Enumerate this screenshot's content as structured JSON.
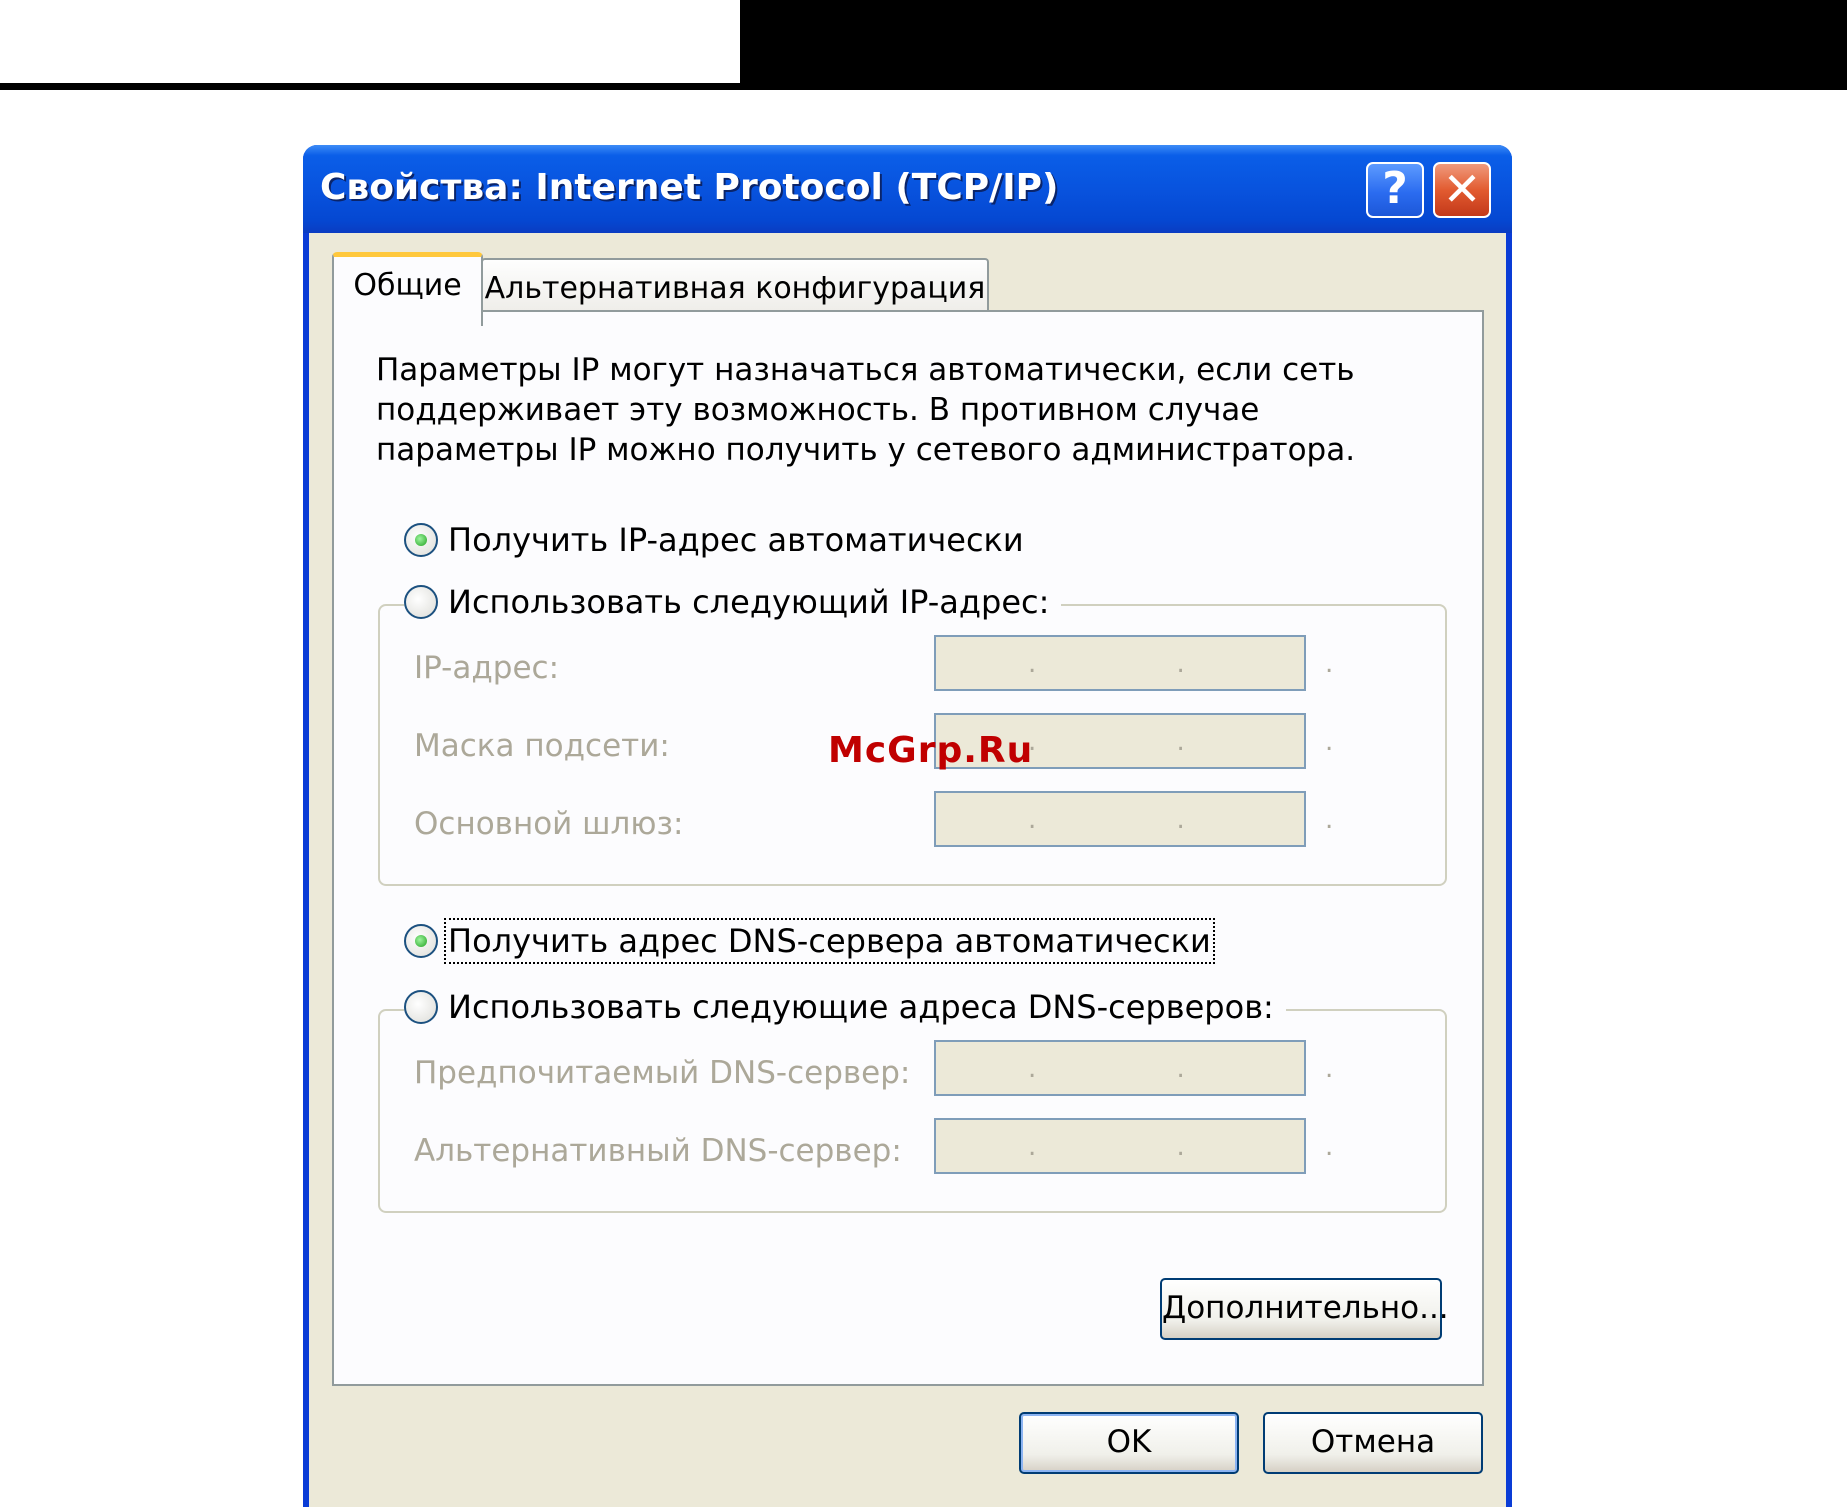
{
  "window": {
    "title": "Свойства: Internet Protocol (TCP/IP)",
    "help_glyph": "?",
    "close_glyph": "✕"
  },
  "tabs": [
    {
      "label": "Общие",
      "active": true
    },
    {
      "label": "Альтернативная конфигурация",
      "active": false
    }
  ],
  "general": {
    "description": "Параметры IP могут назначаться автоматически, если сеть поддерживает эту возможность. В противном случае параметры IP можно получить у сетевого администратора.",
    "ip_mode": {
      "auto_label": "Получить IP-адрес автоматически",
      "manual_label": "Использовать следующий IP-адрес:",
      "selected": "auto"
    },
    "ip_fields": [
      {
        "label": "IP-адрес:",
        "value": ". . ."
      },
      {
        "label": "Маска подсети:",
        "value": ". . ."
      },
      {
        "label": "Основной шлюз:",
        "value": ". . ."
      }
    ],
    "dns_mode": {
      "auto_label": "Получить адрес DNS-сервера автоматически",
      "manual_label": "Использовать следующие адреса DNS-серверов:",
      "selected": "auto"
    },
    "dns_fields": [
      {
        "label": "Предпочитаемый DNS-сервер:",
        "value": ". . ."
      },
      {
        "label": "Альтернативный DNS-сервер:",
        "value": ". . ."
      }
    ],
    "advanced_label": "Дополнительно..."
  },
  "footer": {
    "ok_label": "OK",
    "cancel_label": "Отмена"
  },
  "watermark": "McGrp.Ru",
  "colors": {
    "titlebar": "#0853de",
    "dialog_bg": "#ece9d8",
    "active_tab_accent": "#ffc83c",
    "disabled_text": "#aca899",
    "button_border": "#003c74",
    "watermark": "#c00000"
  }
}
